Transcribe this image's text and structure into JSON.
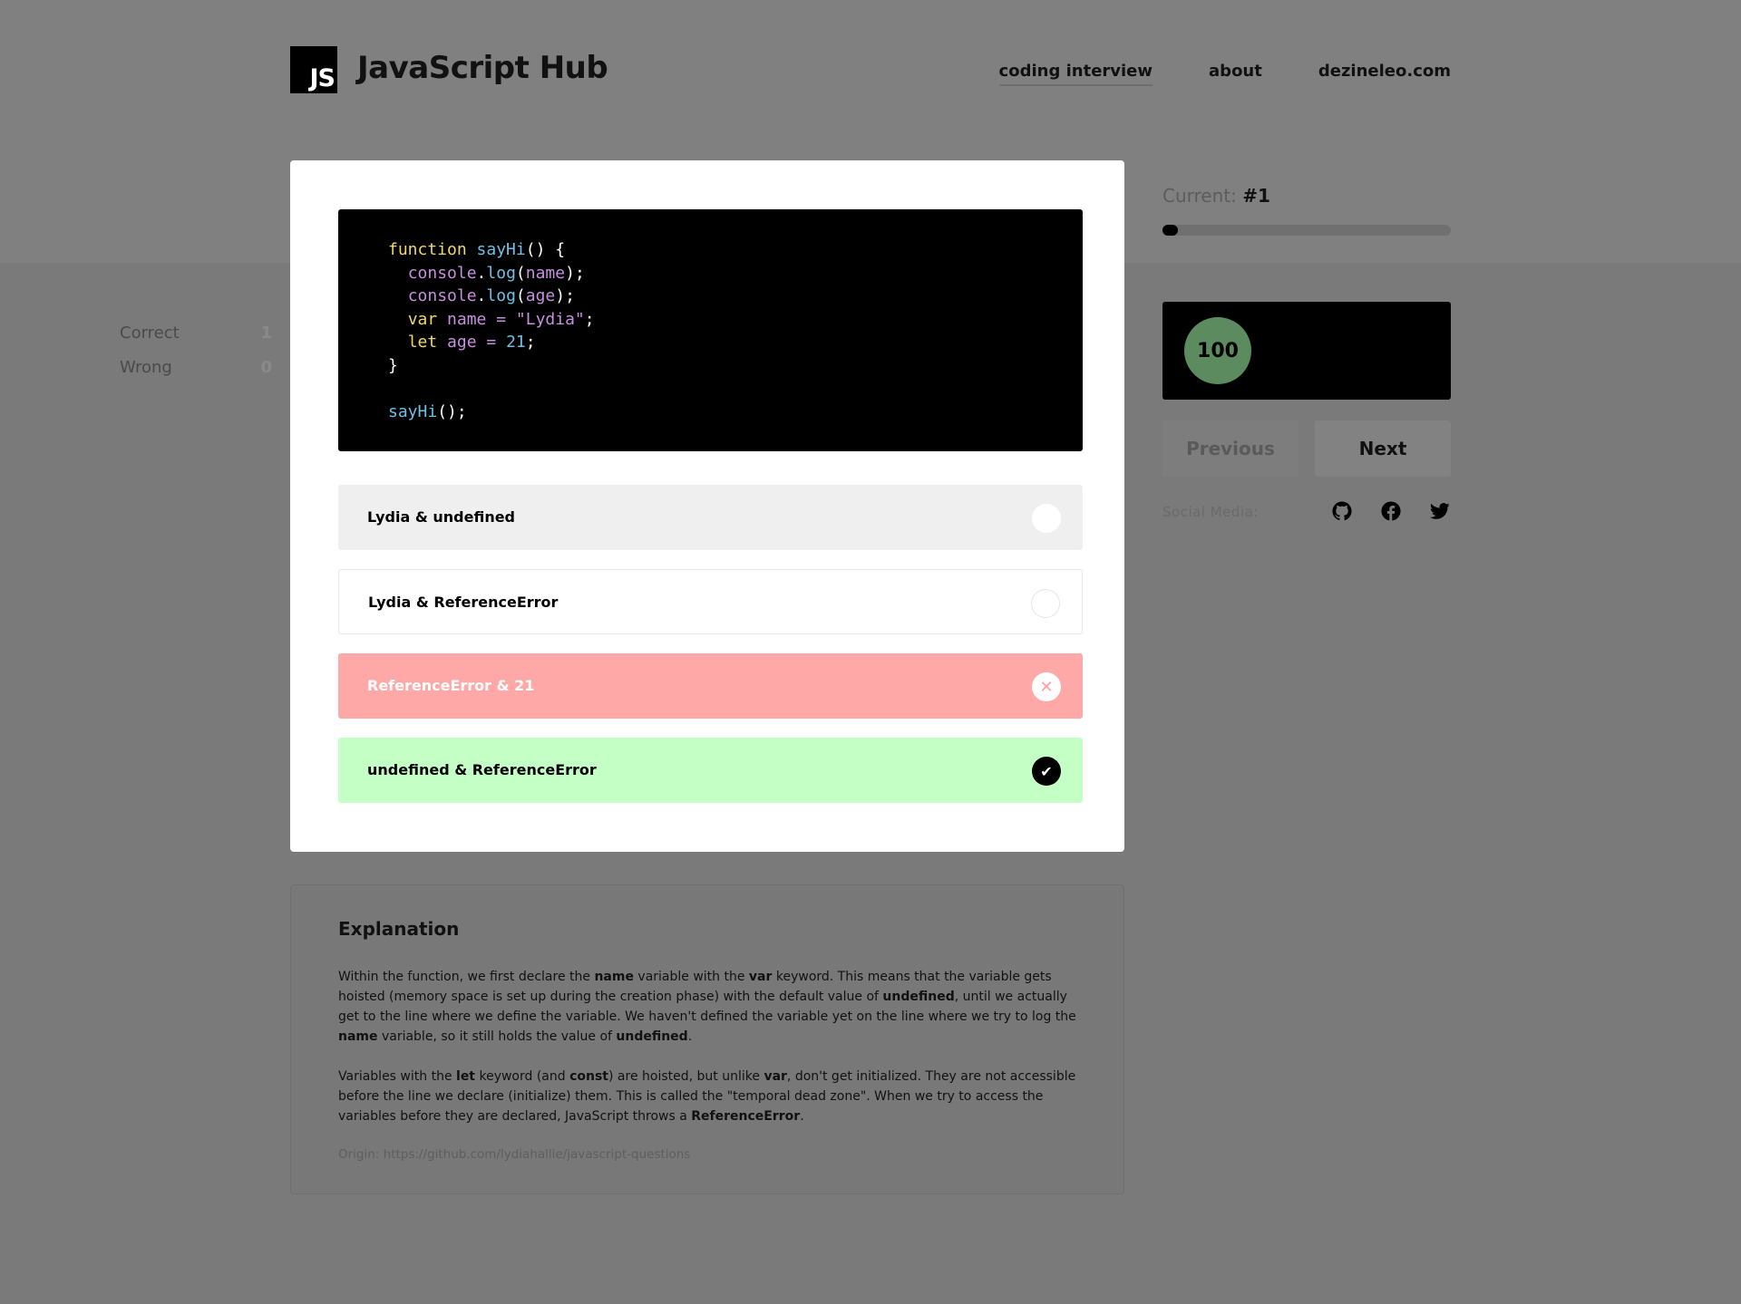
{
  "header": {
    "logo_text": "JS",
    "brand": "JavaScript Hub",
    "nav": [
      {
        "label": "coding interview",
        "active": true
      },
      {
        "label": "about",
        "active": false
      },
      {
        "label": "dezineleo.com",
        "active": false
      }
    ]
  },
  "question": {
    "code_lines": [
      [
        {
          "t": "function ",
          "c": "kw"
        },
        {
          "t": "sayHi",
          "c": "fn"
        },
        {
          "t": "() {",
          "c": "pl"
        }
      ],
      [
        {
          "t": "  ",
          "c": "pl"
        },
        {
          "t": "console",
          "c": "ob"
        },
        {
          "t": ".",
          "c": "pl"
        },
        {
          "t": "log",
          "c": "fn"
        },
        {
          "t": "(",
          "c": "pl"
        },
        {
          "t": "name",
          "c": "ob"
        },
        {
          "t": ");",
          "c": "pl"
        }
      ],
      [
        {
          "t": "  ",
          "c": "pl"
        },
        {
          "t": "console",
          "c": "ob"
        },
        {
          "t": ".",
          "c": "pl"
        },
        {
          "t": "log",
          "c": "fn"
        },
        {
          "t": "(",
          "c": "pl"
        },
        {
          "t": "age",
          "c": "ob"
        },
        {
          "t": ");",
          "c": "pl"
        }
      ],
      [
        {
          "t": "  ",
          "c": "pl"
        },
        {
          "t": "var ",
          "c": "kw"
        },
        {
          "t": "name = ",
          "c": "ob"
        },
        {
          "t": "\"Lydia\"",
          "c": "st"
        },
        {
          "t": ";",
          "c": "pl"
        }
      ],
      [
        {
          "t": "  ",
          "c": "pl"
        },
        {
          "t": "let ",
          "c": "kw"
        },
        {
          "t": "age = ",
          "c": "ob"
        },
        {
          "t": "21",
          "c": "fn"
        },
        {
          "t": ";",
          "c": "pl"
        }
      ],
      [
        {
          "t": "}",
          "c": "pl"
        }
      ],
      [],
      [
        {
          "t": "sayHi",
          "c": "fn"
        },
        {
          "t": "();",
          "c": "pl"
        }
      ]
    ],
    "options": [
      {
        "label": "Lydia & undefined",
        "state": "neutral"
      },
      {
        "label": "Lydia & ReferenceError",
        "state": "neutral"
      },
      {
        "label": "ReferenceError & 21",
        "state": "wrong",
        "icon": "close-icon"
      },
      {
        "label": "undefined & ReferenceError",
        "state": "correct",
        "icon": "check-icon"
      }
    ]
  },
  "explanation": {
    "title": "Explanation",
    "paragraphs": [
      [
        {
          "t": "Within the function, we first declare the "
        },
        {
          "t": "name",
          "b": true
        },
        {
          "t": " variable with the "
        },
        {
          "t": "var",
          "b": true
        },
        {
          "t": " keyword. This means that the variable gets hoisted (memory space is set up during the creation phase) with the default value of "
        },
        {
          "t": "undefined",
          "b": true
        },
        {
          "t": ", until we actually get to the line where we define the variable. We haven't defined the variable yet on the line where we try to log the "
        },
        {
          "t": "name",
          "b": true
        },
        {
          "t": " variable, so it still holds the value of "
        },
        {
          "t": "undefined",
          "b": true
        },
        {
          "t": "."
        }
      ],
      [
        {
          "t": "Variables with the "
        },
        {
          "t": "let",
          "b": true
        },
        {
          "t": " keyword (and "
        },
        {
          "t": "const",
          "b": true
        },
        {
          "t": ") are hoisted, but unlike "
        },
        {
          "t": "var",
          "b": true
        },
        {
          "t": ", don't get initialized. They are not accessible before the line we declare (initialize) them. This is called the \"temporal dead zone\". When we try to access the variables before they are declared, JavaScript throws a "
        },
        {
          "t": "ReferenceError",
          "b": true
        },
        {
          "t": "."
        }
      ]
    ],
    "origin": "Origin: https://github.com/lydiahallie/javascript-questions"
  },
  "sidebar": {
    "current_label": "Current:",
    "current_value": "#1",
    "progress_fraction": 0.055,
    "score": "100",
    "correct_label": "Correct",
    "correct_value": "1",
    "wrong_label": "Wrong",
    "wrong_value": "0",
    "previous_label": "Previous",
    "next_label": "Next",
    "social_label": "Social Media:",
    "social_icons": [
      "github-icon",
      "facebook-icon",
      "twitter-icon"
    ]
  },
  "colors": {
    "wrong": "#ffa8a8",
    "correct": "#c4ffc6",
    "score_circle": "#5d8b60"
  }
}
